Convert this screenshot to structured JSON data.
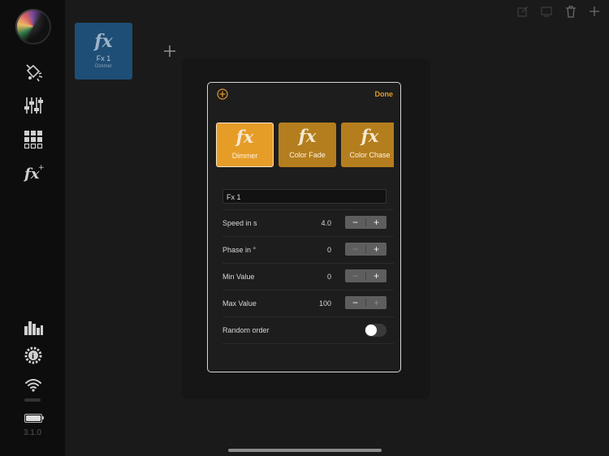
{
  "sidebar": {
    "items": [
      {
        "icon": "paint-bucket-icon"
      },
      {
        "icon": "faders-icon"
      },
      {
        "icon": "grid-icon"
      },
      {
        "icon": "fx-icon"
      }
    ],
    "bottom_items": [
      {
        "icon": "equalizer-icon"
      },
      {
        "icon": "settings-gear-icon"
      },
      {
        "icon": "wifi-icon"
      }
    ],
    "version": "3.1.0"
  },
  "workspace": {
    "effect_tile": {
      "glyph": "fx",
      "title": "Fx 1",
      "subtitle": "Dimmer"
    }
  },
  "toolbar": {
    "icons": [
      "edit-icon",
      "screen-icon",
      "trash-icon",
      "add-icon"
    ]
  },
  "dialog": {
    "done_label": "Done",
    "effect_types": [
      {
        "glyph": "fx",
        "label": "Dimmer",
        "selected": true
      },
      {
        "glyph": "fx",
        "label": "Color Fade",
        "selected": false
      },
      {
        "glyph": "fx",
        "label": "Color Chase",
        "selected": false
      }
    ],
    "name_value": "Fx 1",
    "params": [
      {
        "label": "Speed in s",
        "value": "4.0"
      },
      {
        "label": "Phase in °",
        "value": "0"
      },
      {
        "label": "Min Value",
        "value": "0"
      },
      {
        "label": "Max Value",
        "value": "100"
      }
    ],
    "random_order": {
      "label": "Random order",
      "on": false
    }
  },
  "colors": {
    "accent": "#e39a2b",
    "card_selected": "#e69d28",
    "card": "#b47e1e",
    "tile_blue": "#1e4e76"
  }
}
